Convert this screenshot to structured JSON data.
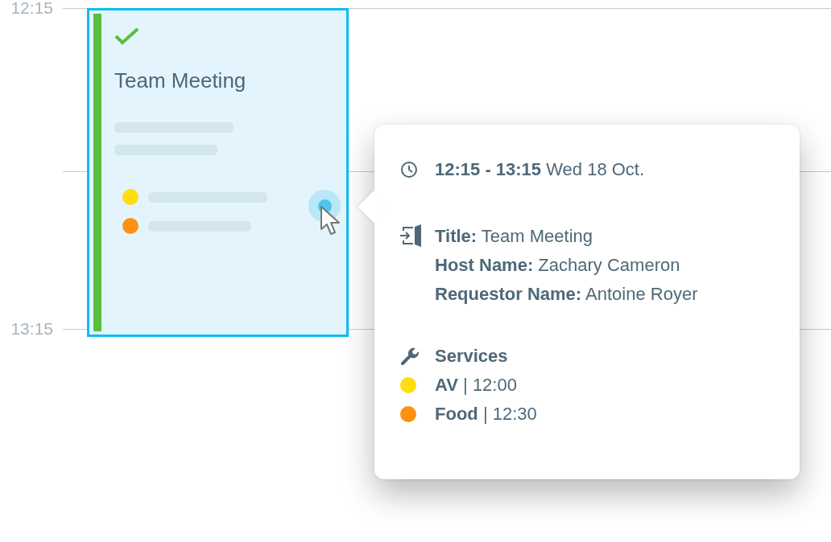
{
  "timeline": {
    "labels": [
      "12:15",
      "13:15"
    ]
  },
  "event": {
    "title": "Team Meeting",
    "confirmed": true,
    "hovered": true
  },
  "popover": {
    "time": "**12:15 - 13:15** Wed 18 Oct.",
    "details": [
      "**Title:** Team Meeting",
      "**Host Name:** Zachary Cameron",
      "**Requestor Name:** Antoine Royer"
    ],
    "services_heading": "Services",
    "services": [
      {
        "text": "**AV** | 12:00",
        "color": "#ffdd11"
      },
      {
        "text": "**Food** | 12:30",
        "color": "#ff9011"
      }
    ]
  }
}
